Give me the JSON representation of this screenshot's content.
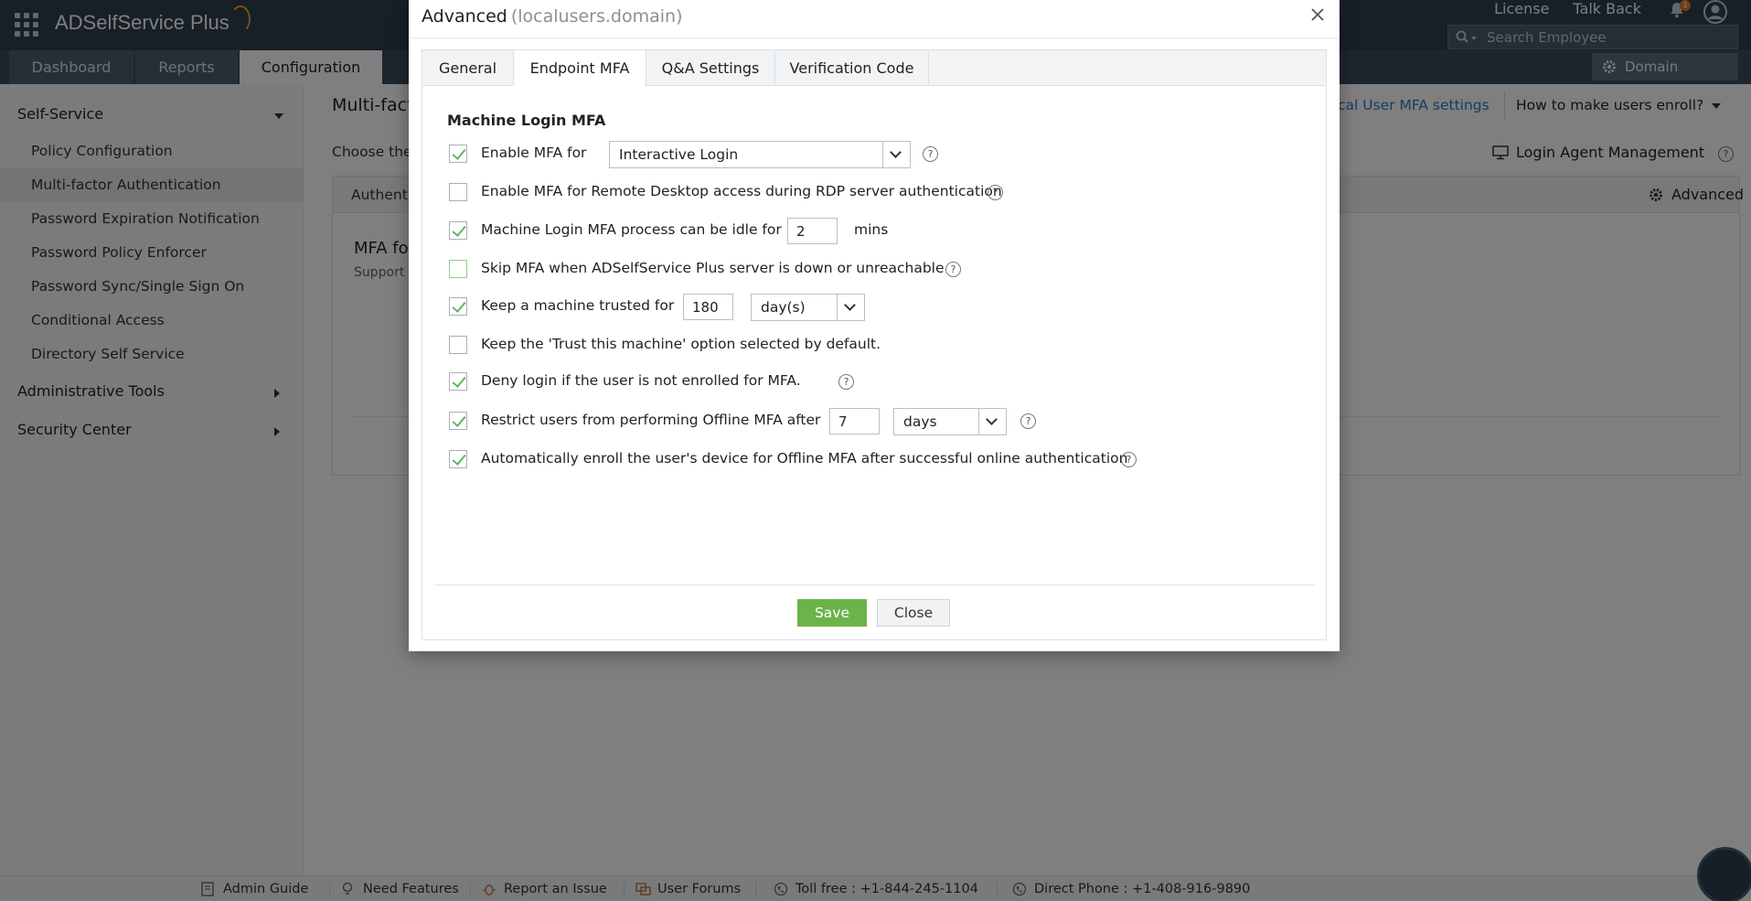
{
  "app": {
    "brand": "ADSelfService Plus"
  },
  "header": {
    "links": [
      "License",
      "Talk Back"
    ],
    "notification_count": "1",
    "search_placeholder": "Search Employee"
  },
  "nav": {
    "tabs": [
      "Dashboard",
      "Reports",
      "Configuration"
    ],
    "active": "Configuration",
    "domain_settings": "Domain Settings"
  },
  "sidebar": {
    "sections": [
      {
        "label": "Self-Service",
        "expanded": true
      },
      {
        "label": "Administrative Tools",
        "expanded": false
      },
      {
        "label": "Security Center",
        "expanded": false
      }
    ],
    "items": [
      "Policy Configuration",
      "Multi-factor Authentication",
      "Password Expiration Notification",
      "Password Policy Enforcer",
      "Password Sync/Single Sign On",
      "Conditional Access",
      "Directory Self Service"
    ],
    "active_item": "Multi-factor Authentication"
  },
  "main": {
    "title": "Multi-fact",
    "local_link": "cal User MFA settings",
    "enroll_link": "How to make users enroll?",
    "choose_text": "Choose the",
    "agent_link": "Login Agent Management",
    "panel_head": "Authenti",
    "advanced": "Advanced",
    "mfa_for": "MFA fo",
    "support_text": "Support"
  },
  "modal": {
    "title": "Advanced",
    "subtitle": "(localusers.domain)",
    "tabs": [
      "General",
      "Endpoint MFA",
      "Q&A Settings",
      "Verification Code"
    ],
    "active_tab": "Endpoint MFA",
    "section_heading": "Machine Login MFA",
    "options": {
      "enable_mfa": {
        "checked": true,
        "label": "Enable MFA for",
        "select_value": "Interactive Login"
      },
      "rdp": {
        "checked": false,
        "label": "Enable MFA for Remote Desktop access during RDP server authentication"
      },
      "idle": {
        "checked": true,
        "label": "Machine Login MFA process can be idle for",
        "value": "2",
        "unit": "mins"
      },
      "skip": {
        "checked": false,
        "label": "Skip MFA when ADSelfService Plus server is down or unreachable"
      },
      "trusted": {
        "checked": true,
        "label": "Keep a machine trusted for",
        "value": "180",
        "select_value": "day(s)"
      },
      "trust_default": {
        "checked": false,
        "label": "Keep the 'Trust this machine' option selected by default."
      },
      "deny": {
        "checked": true,
        "label": "Deny login if the user is not enrolled for MFA."
      },
      "offline": {
        "checked": true,
        "label": "Restrict users from performing Offline MFA after",
        "value": "7",
        "select_value": "days"
      },
      "auto_enroll": {
        "checked": true,
        "label": "Automatically enroll the user's device for Offline MFA after successful online authentication"
      }
    },
    "save": "Save",
    "close": "Close"
  },
  "footer": {
    "items": [
      "Admin Guide",
      "Need Features",
      "Report an Issue",
      "User Forums",
      "Toll free : +1-844-245-1104",
      "Direct Phone : +1-408-916-9890"
    ]
  },
  "colors": {
    "header": "#2f3e4f",
    "accent": "#6cb34a",
    "link": "#2a78c4"
  }
}
